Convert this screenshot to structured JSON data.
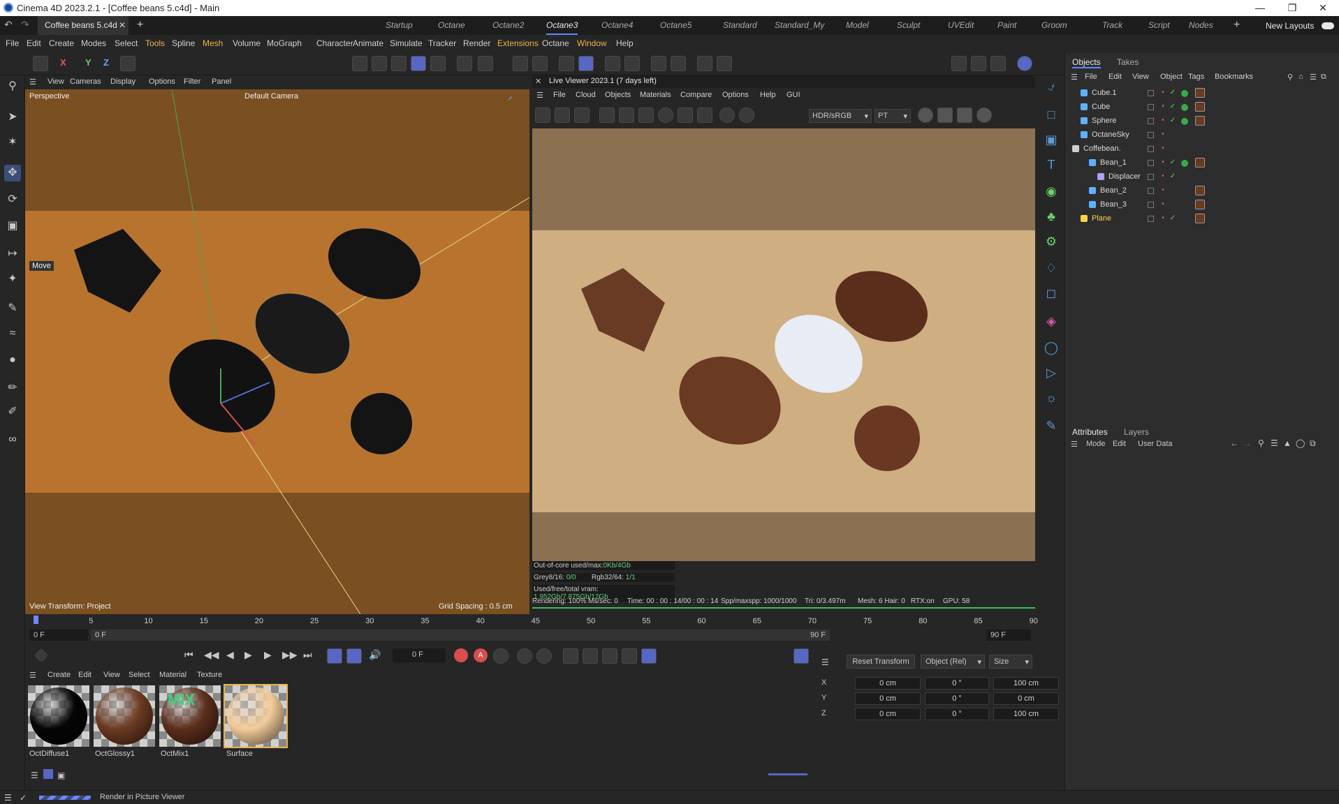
{
  "window": {
    "title": "Cinema 4D 2023.2.1 - [Coffee beans 5.c4d] - Main"
  },
  "tabs": {
    "document": "Coffee beans 5.c4d",
    "new_layouts": "New Layouts"
  },
  "layouts": [
    "Startup",
    "Octane",
    "Octane2",
    "Octane3",
    "Octane4",
    "Octane5",
    "Standard",
    "Standard_My",
    "Model",
    "Sculpt",
    "UVEdit",
    "Paint",
    "Groom",
    "Track",
    "Script",
    "Nodes"
  ],
  "menu": [
    "File",
    "Edit",
    "Create",
    "Modes",
    "Select",
    "Tools",
    "Spline",
    "Mesh",
    "Volume",
    "MoGraph",
    "Character",
    "Animate",
    "Simulate",
    "Tracker",
    "Render",
    "Extensions",
    "Octane",
    "Window",
    "Help"
  ],
  "axis_buttons": [
    "X",
    "Y",
    "Z"
  ],
  "viewport": {
    "menu": [
      "View",
      "Cameras",
      "Display",
      "Options",
      "Filter",
      "Panel"
    ],
    "projection": "Perspective",
    "camera": "Default Camera",
    "tool_label": "Move",
    "view_transform": "View Transform: Project",
    "grid_spacing": "Grid Spacing : 0.5 cm"
  },
  "live_viewer": {
    "title": "Live Viewer 2023.1 (7 days left)",
    "menu": [
      "File",
      "Cloud",
      "Objects",
      "Materials",
      "Compare",
      "Options",
      "Help",
      "GUI"
    ],
    "color_space": "HDR/sRGB",
    "kernel": "PT",
    "stats": {
      "out_of_core_label": "Out-of-core used/max:",
      "out_of_core_value": "0Kb/4Gb",
      "grey_label": "Grey8/16:",
      "grey_value": "0/0",
      "rgb_label": "Rgb32/64:",
      "rgb_value": "1/1",
      "vram_label": "Used/free/total vram:",
      "vram_value": "1.952Gb/7.875Gb/12Gb",
      "rendering": "Rendering: 100%  Ms/sec: 0",
      "time": "Time: 00 : 00 : 14/00 : 00 : 14",
      "spp": "Spp/maxspp: 1000/1000",
      "tri": "Tri: 0/3.497m",
      "mesh": "Mesh: 6  Hair: 0",
      "rtx": "RTX:on",
      "gpu": "GPU:  58"
    },
    "progress": 1.0
  },
  "objects_panel": {
    "tabs": [
      "Objects",
      "Takes"
    ],
    "menu": [
      "File",
      "Edit",
      "View",
      "Object",
      "Tags",
      "Bookmarks"
    ],
    "items": [
      {
        "name": "Cube.1",
        "indent": 1,
        "icon": "null-icon",
        "color": "#5fb0ff"
      },
      {
        "name": "Cube",
        "indent": 1,
        "icon": "cube-icon",
        "color": "#5fb0ff"
      },
      {
        "name": "Sphere",
        "indent": 1,
        "icon": "sphere-icon",
        "color": "#5fb0ff"
      },
      {
        "name": "OctaneSky",
        "indent": 1,
        "icon": "sky-icon",
        "color": "#5fb0ff"
      },
      {
        "name": "Coffebean.",
        "indent": 0,
        "icon": "null-icon",
        "color": "#d0d0d0"
      },
      {
        "name": "Bean_1",
        "indent": 2,
        "icon": "mesh-icon",
        "color": "#5fb0ff"
      },
      {
        "name": "Displacer",
        "indent": 3,
        "icon": "deformer-icon",
        "color": "#b0a0ff"
      },
      {
        "name": "Bean_2",
        "indent": 2,
        "icon": "mesh-icon",
        "color": "#5fb0ff"
      },
      {
        "name": "Bean_3",
        "indent": 2,
        "icon": "mesh-icon",
        "color": "#5fb0ff"
      },
      {
        "name": "Plane",
        "indent": 1,
        "icon": "plane-icon",
        "color": "#ffd24a"
      }
    ]
  },
  "attributes_panel": {
    "tabs": [
      "Attributes",
      "Layers"
    ],
    "menu": [
      "Mode",
      "Edit",
      "User Data"
    ]
  },
  "timeline": {
    "ticks": [
      "0",
      "5",
      "10",
      "15",
      "20",
      "25",
      "30",
      "35",
      "40",
      "45",
      "50",
      "55",
      "60",
      "65",
      "70",
      "75",
      "80",
      "85",
      "90"
    ],
    "start": "0 F",
    "start2": "0 F",
    "end": "90 F",
    "end2": "90 F",
    "current": "0 F"
  },
  "coordinates": {
    "reset": "Reset Transform",
    "mode": "Object (Rel)",
    "size_mode": "Size",
    "rows": [
      {
        "axis": "X",
        "pos": "0 cm",
        "rot": "0 °",
        "size": "100 cm"
      },
      {
        "axis": "Y",
        "pos": "0 cm",
        "rot": "0 °",
        "size": "0 cm"
      },
      {
        "axis": "Z",
        "pos": "0 cm",
        "rot": "0 °",
        "size": "100 cm"
      }
    ]
  },
  "materials": {
    "menu": [
      "Create",
      "Edit",
      "View",
      "Select",
      "Material",
      "Texture"
    ],
    "items": [
      {
        "name": "OctDiffuse1",
        "color": "#050505",
        "overlay": ""
      },
      {
        "name": "OctGlossy1",
        "color": "#6b3a22",
        "overlay": ""
      },
      {
        "name": "OctMix1",
        "color": "#5b2e1c",
        "overlay": "MIX"
      },
      {
        "name": "Surface",
        "color": "#f2cb9a",
        "overlay": ""
      }
    ]
  },
  "status": {
    "text": "Render in Picture Viewer"
  },
  "colors": {
    "accent": "#5a8cff",
    "panel": "#262626",
    "viewport": "#b8742f"
  }
}
